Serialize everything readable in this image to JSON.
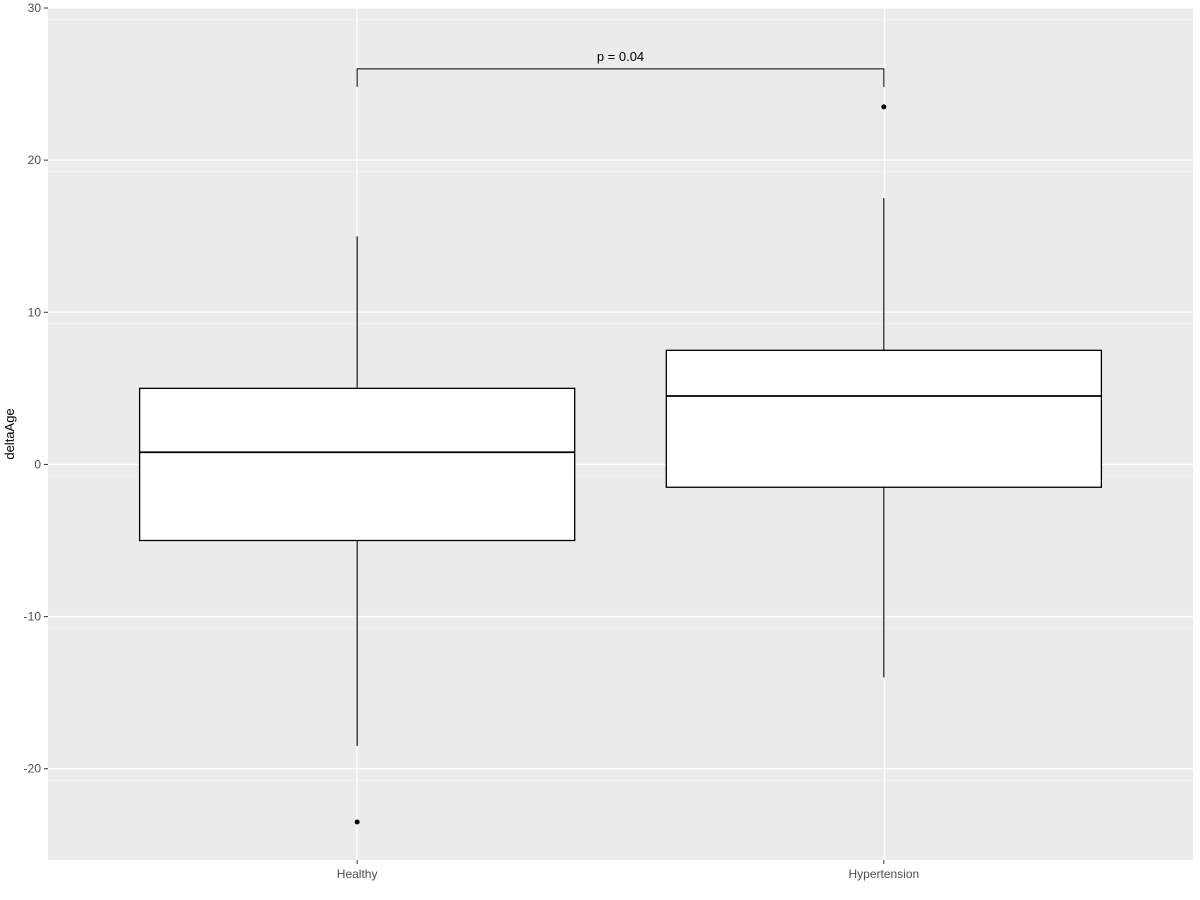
{
  "chart_data": {
    "type": "boxplot",
    "ylabel": "deltaAge",
    "xlabel": "",
    "ylim": [
      -26,
      30
    ],
    "y_ticks": [
      -20,
      -10,
      0,
      10,
      20,
      30
    ],
    "categories": [
      "Healthy",
      "Hypertension"
    ],
    "series": [
      {
        "name": "Healthy",
        "min": -18.5,
        "q1": -5.0,
        "median": 0.8,
        "q3": 5.0,
        "max": 15.0,
        "outliers": [
          -23.5
        ]
      },
      {
        "name": "Hypertension",
        "min": -14.0,
        "q1": -1.5,
        "median": 4.5,
        "q3": 7.5,
        "max": 17.5,
        "outliers": [
          23.5
        ]
      }
    ],
    "annotation": {
      "label": "p = 0.04",
      "y": 26
    },
    "title": ""
  }
}
